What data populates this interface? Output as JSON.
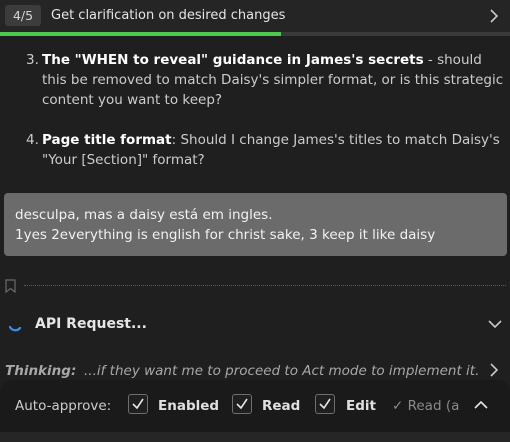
{
  "task": {
    "step_badge": "4/5",
    "title": "Get clarification on desired changes",
    "progress": 0.55,
    "colors": {
      "progress": "#4ec94e"
    }
  },
  "questions": [
    {
      "number": "3.",
      "bold": "The \"WHEN to reveal\" guidance in James's secrets",
      "rest": " - should this be removed to match Daisy's simpler format, or is this strategic content you want to keep?"
    },
    {
      "number": "4.",
      "bold": "Page title format",
      "rest": ": Should I change James's titles to match Daisy's \"Your [Section]\" format?"
    }
  ],
  "user_message": {
    "line1": "desculpa, mas a daisy está em ingles.",
    "line2": "1yes 2everything is english for christ sake, 3 keep it like daisy"
  },
  "api_request": {
    "label": "API Request..."
  },
  "thinking": {
    "label": "Thinking:",
    "text": "...if they want me to proceed to Act mode to implement it."
  },
  "auto_approve": {
    "label": "Auto-approve:",
    "options": [
      {
        "label": "Enabled",
        "checked": true
      },
      {
        "label": "Read",
        "checked": true
      },
      {
        "label": "Edit",
        "checked": true
      }
    ],
    "more": "✓ Read (a"
  },
  "icons": {
    "header_chevron": "chevron-right-icon",
    "bookmark": "bookmark-icon",
    "spinner": "spinner-icon",
    "api_chevron": "chevron-down-icon",
    "thinking_chevron": "chevron-right-icon",
    "collapse_chevron": "chevron-up-icon"
  }
}
